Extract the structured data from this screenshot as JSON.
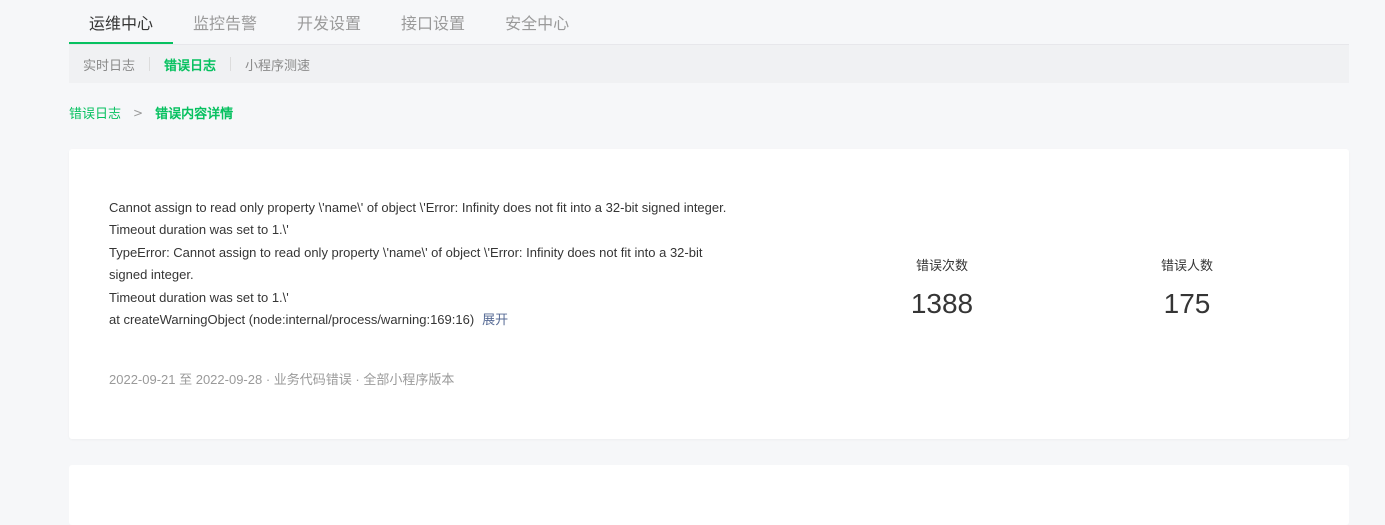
{
  "tabs": [
    {
      "label": "运维中心",
      "active": true
    },
    {
      "label": "监控告警",
      "active": false
    },
    {
      "label": "开发设置",
      "active": false
    },
    {
      "label": "接口设置",
      "active": false
    },
    {
      "label": "安全中心",
      "active": false
    }
  ],
  "subnav": [
    {
      "label": "实时日志",
      "active": false
    },
    {
      "label": "错误日志",
      "active": true
    },
    {
      "label": "小程序测速",
      "active": false
    }
  ],
  "breadcrumb": {
    "parent": "错误日志",
    "separator": ">",
    "current": "错误内容详情"
  },
  "error": {
    "lines": [
      "Cannot assign to read only property \\'name\\' of object \\'Error: Infinity does not fit into a 32-bit signed integer.",
      "Timeout duration was set to 1.\\'",
      "TypeError: Cannot assign to read only property \\'name\\' of object \\'Error: Infinity does not fit into a 32-bit signed integer.",
      "Timeout duration was set to 1.\\'"
    ],
    "last_line": "at createWarningObject (node:internal/process/warning:169:16)",
    "expand_label": "展开",
    "meta": "2022-09-21 至  2022-09-28 · 业务代码错误 · 全部小程序版本"
  },
  "stats": {
    "count_label": "错误次数",
    "count_value": "1388",
    "users_label": "错误人数",
    "users_value": "175"
  },
  "colors": {
    "accent": "#07c160",
    "link": "#576b95"
  }
}
